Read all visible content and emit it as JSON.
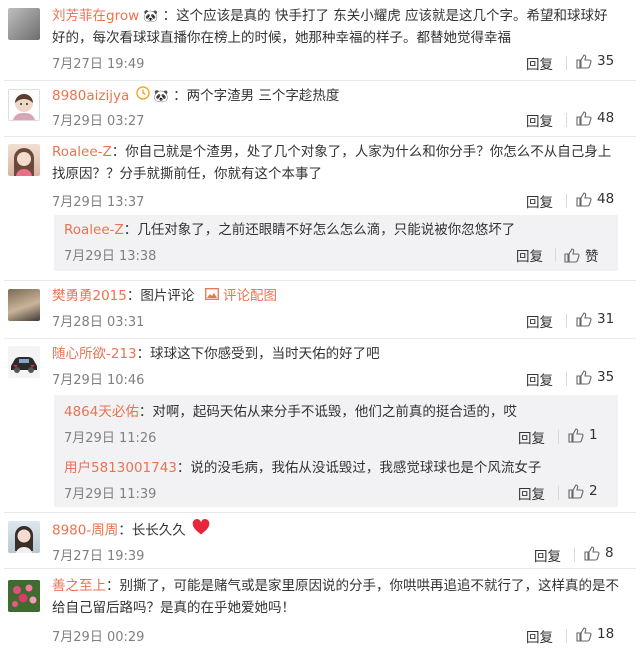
{
  "comments": [
    {
      "user": "刘芳菲在grow",
      "text": "：这个应该是真的 快手打了 东关小耀虎 应该就是这几个字。希望和球球好好的，每次看球球直播你在榜上的时候，她那种幸福的样子。都替她觉得幸福",
      "time": "7月27日 19:49",
      "reply": "回复",
      "likes": "35"
    },
    {
      "user": "8980aizijya",
      "text": "：两个字渣男 三个字趁热度",
      "time": "7月29日 03:27",
      "reply": "回复",
      "likes": "48"
    },
    {
      "user": "Roalee-Z",
      "text": "：你自己就是个渣男，处了几个对象了，人家为什么和你分手？你怎么不从自己身上找原因？？分手就撕前任，你就有这个本事了",
      "time": "7月29日 13:37",
      "reply": "回复",
      "likes": "48",
      "sub_replies": [
        {
          "user": "Roalee-Z",
          "text": "：几任对象了，之前还眼睛不好怎么怎么滴，只能说被你忽悠坏了",
          "time": "7月29日 13:38",
          "reply": "回复",
          "likes": "赞"
        }
      ]
    },
    {
      "user": "樊勇勇2015",
      "text": "：图片评论",
      "image_link": "评论配图",
      "time": "7月28日 03:31",
      "reply": "回复",
      "likes": "31"
    },
    {
      "user": "随心所欲-213",
      "text": "：球球这下你感受到，当时天佑的好了吧",
      "time": "7月29日 10:46",
      "reply": "回复",
      "likes": "35",
      "sub_replies": [
        {
          "user": "4864天必佑",
          "text": "：对啊，起码天佑从来分手不诋毁，他们之前真的挺合适的，哎",
          "time": "7月29日 11:26",
          "reply": "回复",
          "likes": "1"
        },
        {
          "user": "用户5813001743",
          "text": "：说的没毛病，我佑从没诋毁过，我感觉球球也是个风流女子",
          "time": "7月29日 11:39",
          "reply": "回复",
          "likes": "2"
        }
      ]
    },
    {
      "user": "8980-周周",
      "text": "：长长久久",
      "time": "7月27日 19:39",
      "reply": "回复",
      "likes": "8"
    },
    {
      "user": "善之至上",
      "text": "：别撕了，可能是赌气或是家里原因说的分手，你哄哄再追追不就行了，这样真的是不给自己留后路吗？是真的在乎她爱她吗！",
      "time": "7月29日 00:29",
      "reply": "回复",
      "likes": "18"
    }
  ],
  "colors": {
    "username": "#eb7350",
    "text": "#333333",
    "meta": "#808080",
    "sub_bg": "#f2f2f5",
    "divider": "#e9e9e9"
  },
  "icons": {
    "like": "thumbs-up-icon",
    "panda": "panda-emoji-icon",
    "heart": "red-heart-emoji-icon",
    "image": "image-icon",
    "clock": "vip-clock-badge-icon"
  }
}
